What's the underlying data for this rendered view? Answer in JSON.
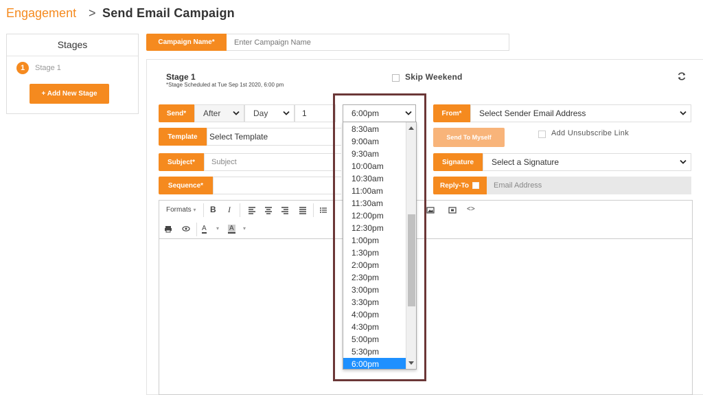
{
  "breadcrumb": {
    "root": "Engagement",
    "separator": ">",
    "page": "Send Email Campaign"
  },
  "stages": {
    "title": "Stages",
    "items": [
      {
        "number": "1",
        "label": "Stage 1"
      }
    ],
    "add_label": "+ Add New Stage"
  },
  "campaign": {
    "label": "Campaign Name*",
    "placeholder": "Enter Campaign Name"
  },
  "stage": {
    "title": "Stage 1",
    "schedule": "*Stage Scheduled at Tue Sep 1st 2020, 6:00 pm",
    "skip_weekend": "Skip Weekend"
  },
  "send": {
    "label": "Send*",
    "when": "After",
    "unit": "Day",
    "count": "1",
    "time": "6:00pm"
  },
  "time_options": [
    "8:30am",
    "9:00am",
    "9:30am",
    "10:00am",
    "10:30am",
    "11:00am",
    "11:30am",
    "12:00pm",
    "12:30pm",
    "1:00pm",
    "1:30pm",
    "2:00pm",
    "2:30pm",
    "3:00pm",
    "3:30pm",
    "4:00pm",
    "4:30pm",
    "5:00pm",
    "5:30pm",
    "6:00pm"
  ],
  "selected_time_index": 19,
  "from": {
    "label": "From*",
    "value": "Select Sender Email Address"
  },
  "template": {
    "label": "Template",
    "value": "Select Template"
  },
  "send_to_myself": "Send To Myself",
  "unsubscribe": "Add Unsubscribe Link",
  "subject": {
    "label": "Subject*",
    "placeholder": "Subject"
  },
  "signature": {
    "label": "Signature",
    "value": "Select a Signature"
  },
  "sequence": {
    "label": "Sequence*"
  },
  "reply_to": {
    "label": "Reply-To",
    "placeholder": "Email Address"
  },
  "editor": {
    "formats_label": "Formats"
  },
  "colors": {
    "accent": "#f58a1f",
    "selected": "#1e90ff",
    "highlight": "#6b3737"
  }
}
